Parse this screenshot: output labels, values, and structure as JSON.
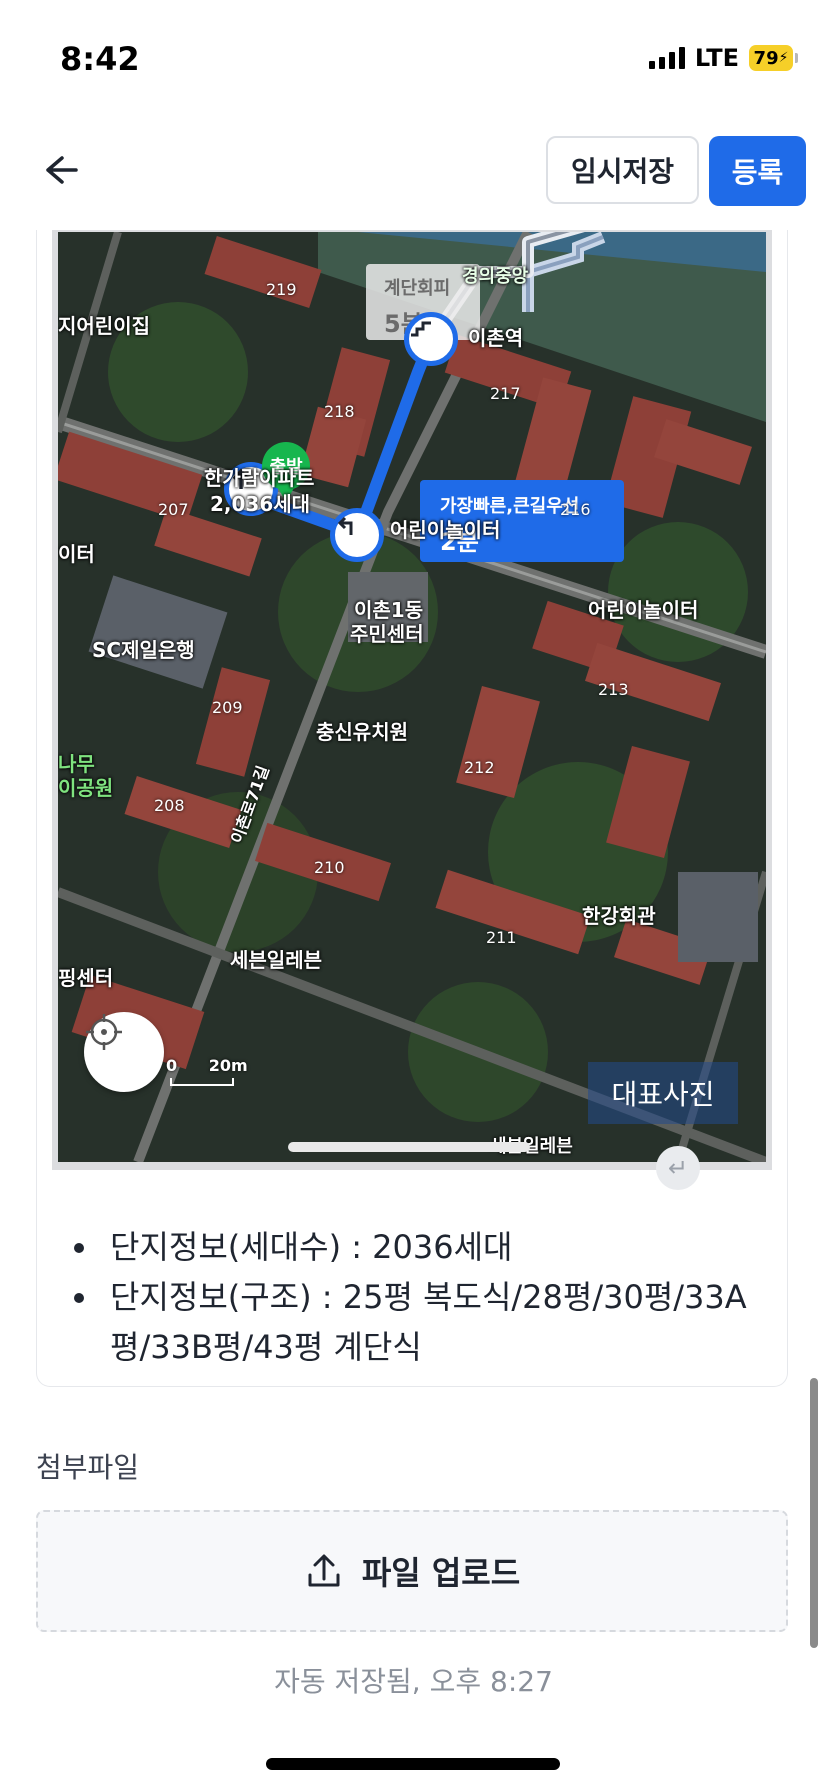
{
  "status": {
    "time": "8:42",
    "network": "LTE",
    "battery": "79"
  },
  "header": {
    "temp_save": "임시저장",
    "register": "등록"
  },
  "map": {
    "stairs_caption_title": "계단회피",
    "stairs_caption_time": "5분",
    "fast_caption_title": "가장빠른,큰길우선",
    "fast_caption_time": "2분",
    "start_label": "출발",
    "labels": {
      "station": "이촌역",
      "line": "경의중앙",
      "kindergarten_left": "지어린이집",
      "apartment": "한가람아파트",
      "households": "2,036세대",
      "playground": "어린이놀이터",
      "playground_right": "어린이놀이터",
      "playground_left": "이터",
      "community": "이촌1동",
      "community2": "주민센터",
      "bank": "SC제일은행",
      "kinder": "충신유치원",
      "park1": "나무",
      "park2": "이공원",
      "road": "이촌로71길",
      "hall": "한강회관",
      "store": "세븐일레븐",
      "center": "핑센터",
      "store2": "세븐일레븐"
    },
    "buildings": [
      "219",
      "218",
      "217",
      "216",
      "207",
      "213",
      "209",
      "212",
      "208",
      "210",
      "211"
    ],
    "scale": {
      "zero": "0",
      "length": "20m"
    },
    "rep_photo": "대표사진"
  },
  "info": {
    "households": "단지정보(세대수) : 2036세대",
    "structure": "단지정보(구조) : 25평 복도식/28평/30평/33A평/33B평/43평 계단식"
  },
  "attachments": {
    "label": "첨부파일",
    "upload": "파일 업로드"
  },
  "autosave": "자동 저장됨, 오후 8:27"
}
